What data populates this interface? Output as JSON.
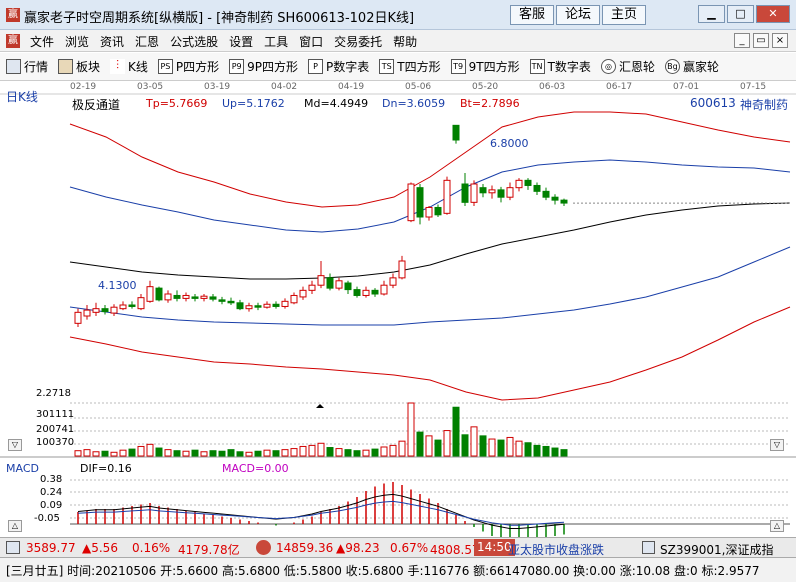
{
  "window": {
    "app_glyph": "赢",
    "title": "赢家老子时空周期系统[纵横版] - [神奇制药  SH600613-102日K线]",
    "buttons": [
      "客服",
      "论坛",
      "主页"
    ],
    "controls": [
      "▁",
      "□",
      "✕"
    ]
  },
  "menu": {
    "items": [
      "文件",
      "浏览",
      "资讯",
      "汇恩",
      "公式选股",
      "设置",
      "工具",
      "窗口",
      "交易委托",
      "帮助"
    ],
    "mdi_controls": [
      "_",
      "▭",
      "×"
    ]
  },
  "toolbar": {
    "items": [
      {
        "label": "行情",
        "icon": "grid-icon"
      },
      {
        "label": "板块",
        "icon": "blocks-icon"
      },
      {
        "label": "K线",
        "icon": "candle-icon"
      },
      {
        "label": "P四方形",
        "icon": "ps-icon",
        "glyph": "PS"
      },
      {
        "label": "9P四方形",
        "icon": "p9-icon",
        "glyph": "P9"
      },
      {
        "label": "P数字表",
        "icon": "p-table-icon",
        "glyph": "P"
      },
      {
        "label": "T四方形",
        "icon": "ts-icon",
        "glyph": "TS"
      },
      {
        "label": "9T四方形",
        "icon": "t9-icon",
        "glyph": "T9"
      },
      {
        "label": "T数字表",
        "icon": "tn-icon",
        "glyph": "TN"
      },
      {
        "label": "汇恩轮",
        "icon": "wheel-icon",
        "glyph": "◎"
      },
      {
        "label": "赢家轮",
        "icon": "big-icon",
        "glyph": "Bg"
      }
    ]
  },
  "chart": {
    "period_label": "日K线",
    "dates": [
      "02-19",
      "03-05",
      "03-19",
      "04-02",
      "04-19",
      "05-06",
      "05-20",
      "06-03",
      "06-17",
      "07-01",
      "07-15"
    ],
    "indicator_name": "极反通道",
    "params": [
      {
        "label": "Tp=5.7669",
        "color": "#d00000"
      },
      {
        "label": "Up=5.1762",
        "color": "#1a3fa8"
      },
      {
        "label": "Md=4.4949",
        "color": "#000000"
      },
      {
        "label": "Dn=3.6059",
        "color": "#1a3fa8"
      },
      {
        "label": "Bt=2.7896",
        "color": "#d00000"
      }
    ],
    "stock_code": "600613",
    "stock_name": "神奇制药",
    "high_label": "6.8000",
    "low_label": "4.1300",
    "volume_labels": [
      "2.2718",
      "301111",
      "200741",
      "100370"
    ],
    "macd_title": "MACD",
    "dif_label": "DIF=0.16",
    "macd_label": "MACD=0.00",
    "macd_axis": [
      "0.38",
      "0.24",
      "0.09",
      "-0.05"
    ],
    "colors": {
      "up": "#d00000",
      "down": "#008000",
      "ma": "#000000",
      "band": "#1a3fa8"
    }
  },
  "status": {
    "index1_value": "3589.77",
    "index1_change": "▲5.56",
    "index1_pct": "0.16%",
    "index1_amount": "4179.78亿",
    "index2_value": "14859.36",
    "index2_change": "▲98.23",
    "index2_pct": "0.67%",
    "index2_amount": "4808.57亿",
    "time": "14:50",
    "scroll_news": "亚太股市收盘涨跌",
    "stock_ref": "SZ399001,深证成指"
  },
  "infobar": {
    "text": "[三月廿五] 时间:20210506 开:5.6600 高:5.6800 低:5.5800 收:5.6800 手:116776 额:66147080.00 换:0.00 涨:10.08 盘:0 标:2.9577"
  },
  "chart_data": {
    "type": "candlestick",
    "title": "神奇制药 SH600613 日K线",
    "price_range": [
      3.6,
      6.8
    ],
    "candles": [
      {
        "o": 4.1,
        "c": 4.25,
        "h": 4.3,
        "l": 4.05
      },
      {
        "o": 4.2,
        "c": 4.28,
        "h": 4.35,
        "l": 4.15
      },
      {
        "o": 4.25,
        "c": 4.3,
        "h": 4.38,
        "l": 4.2
      },
      {
        "o": 4.3,
        "c": 4.26,
        "h": 4.35,
        "l": 4.22
      },
      {
        "o": 4.24,
        "c": 4.32,
        "h": 4.36,
        "l": 4.2
      },
      {
        "o": 4.3,
        "c": 4.35,
        "h": 4.4,
        "l": 4.28
      },
      {
        "o": 4.35,
        "c": 4.33,
        "h": 4.4,
        "l": 4.3
      },
      {
        "o": 4.3,
        "c": 4.45,
        "h": 4.5,
        "l": 4.28
      },
      {
        "o": 4.4,
        "c": 4.6,
        "h": 4.68,
        "l": 4.38
      },
      {
        "o": 4.58,
        "c": 4.42,
        "h": 4.6,
        "l": 4.4
      },
      {
        "o": 4.42,
        "c": 4.5,
        "h": 4.55,
        "l": 4.38
      },
      {
        "o": 4.48,
        "c": 4.44,
        "h": 4.55,
        "l": 4.4
      },
      {
        "o": 4.44,
        "c": 4.48,
        "h": 4.52,
        "l": 4.4
      },
      {
        "o": 4.46,
        "c": 4.44,
        "h": 4.5,
        "l": 4.4
      },
      {
        "o": 4.44,
        "c": 4.47,
        "h": 4.5,
        "l": 4.4
      },
      {
        "o": 4.46,
        "c": 4.43,
        "h": 4.5,
        "l": 4.4
      },
      {
        "o": 4.42,
        "c": 4.4,
        "h": 4.46,
        "l": 4.36
      },
      {
        "o": 4.4,
        "c": 4.38,
        "h": 4.45,
        "l": 4.35
      },
      {
        "o": 4.38,
        "c": 4.3,
        "h": 4.42,
        "l": 4.28
      },
      {
        "o": 4.3,
        "c": 4.34,
        "h": 4.38,
        "l": 4.26
      },
      {
        "o": 4.34,
        "c": 4.32,
        "h": 4.38,
        "l": 4.28
      },
      {
        "o": 4.32,
        "c": 4.36,
        "h": 4.4,
        "l": 4.3
      },
      {
        "o": 4.36,
        "c": 4.33,
        "h": 4.4,
        "l": 4.3
      },
      {
        "o": 4.33,
        "c": 4.4,
        "h": 4.44,
        "l": 4.3
      },
      {
        "o": 4.38,
        "c": 4.48,
        "h": 4.52,
        "l": 4.36
      },
      {
        "o": 4.46,
        "c": 4.55,
        "h": 4.6,
        "l": 4.42
      },
      {
        "o": 4.55,
        "c": 4.62,
        "h": 4.68,
        "l": 4.5
      },
      {
        "o": 4.62,
        "c": 4.75,
        "h": 4.95,
        "l": 4.58
      },
      {
        "o": 4.72,
        "c": 4.58,
        "h": 4.78,
        "l": 4.55
      },
      {
        "o": 4.58,
        "c": 4.68,
        "h": 4.72,
        "l": 4.55
      },
      {
        "o": 4.65,
        "c": 4.56,
        "h": 4.68,
        "l": 4.5
      },
      {
        "o": 4.56,
        "c": 4.48,
        "h": 4.6,
        "l": 4.45
      },
      {
        "o": 4.48,
        "c": 4.55,
        "h": 4.6,
        "l": 4.45
      },
      {
        "o": 4.55,
        "c": 4.5,
        "h": 4.58,
        "l": 4.46
      },
      {
        "o": 4.5,
        "c": 4.62,
        "h": 4.68,
        "l": 4.48
      },
      {
        "o": 4.62,
        "c": 4.72,
        "h": 4.78,
        "l": 4.58
      },
      {
        "o": 4.72,
        "c": 4.95,
        "h": 5.02,
        "l": 4.7
      },
      {
        "o": 5.5,
        "c": 6.0,
        "h": 6.02,
        "l": 5.48
      },
      {
        "o": 5.95,
        "c": 5.55,
        "h": 6.0,
        "l": 5.45
      },
      {
        "o": 5.55,
        "c": 5.68,
        "h": 5.7,
        "l": 5.5
      },
      {
        "o": 5.68,
        "c": 5.58,
        "h": 5.72,
        "l": 5.55
      },
      {
        "o": 5.6,
        "c": 6.05,
        "h": 6.1,
        "l": 5.58
      },
      {
        "o": 6.8,
        "c": 6.6,
        "h": 6.8,
        "l": 6.55
      },
      {
        "o": 6.0,
        "c": 5.75,
        "h": 6.15,
        "l": 5.7
      },
      {
        "o": 5.75,
        "c": 6.0,
        "h": 6.05,
        "l": 5.7
      },
      {
        "o": 5.95,
        "c": 5.88,
        "h": 6.0,
        "l": 5.82
      },
      {
        "o": 5.88,
        "c": 5.92,
        "h": 5.98,
        "l": 5.8
      },
      {
        "o": 5.92,
        "c": 5.82,
        "h": 5.96,
        "l": 5.75
      },
      {
        "o": 5.82,
        "c": 5.95,
        "h": 6.02,
        "l": 5.78
      },
      {
        "o": 5.95,
        "c": 6.05,
        "h": 6.08,
        "l": 5.9
      },
      {
        "o": 6.05,
        "c": 5.98,
        "h": 6.08,
        "l": 5.92
      },
      {
        "o": 5.98,
        "c": 5.9,
        "h": 6.02,
        "l": 5.85
      },
      {
        "o": 5.9,
        "c": 5.82,
        "h": 5.95,
        "l": 5.78
      },
      {
        "o": 5.82,
        "c": 5.78,
        "h": 5.86,
        "l": 5.72
      },
      {
        "o": 5.78,
        "c": 5.74,
        "h": 5.8,
        "l": 5.7
      }
    ],
    "volumes": [
      10,
      12,
      8,
      9,
      7,
      11,
      13,
      18,
      22,
      15,
      12,
      10,
      9,
      11,
      8,
      10,
      9,
      12,
      8,
      7,
      9,
      11,
      10,
      12,
      14,
      18,
      20,
      24,
      16,
      14,
      12,
      10,
      11,
      13,
      17,
      20,
      28,
      100,
      45,
      38,
      30,
      48,
      92,
      40,
      55,
      38,
      32,
      30,
      35,
      28,
      25,
      20,
      18,
      15,
      12
    ],
    "macd_hist": [
      0.08,
      0.09,
      0.1,
      0.1,
      0.1,
      0.11,
      0.12,
      0.13,
      0.14,
      0.12,
      0.11,
      0.1,
      0.09,
      0.08,
      0.07,
      0.06,
      0.05,
      0.04,
      0.03,
      0.02,
      0.01,
      0.0,
      -0.01,
      0.0,
      0.01,
      0.03,
      0.05,
      0.08,
      0.1,
      0.12,
      0.15,
      0.18,
      0.22,
      0.25,
      0.27,
      0.28,
      0.26,
      0.23,
      0.2,
      0.17,
      0.14,
      0.1,
      0.06,
      0.02,
      -0.02,
      -0.05,
      -0.08,
      -0.1,
      -0.12,
      -0.12,
      -0.11,
      -0.1,
      -0.09,
      -0.08,
      -0.07
    ]
  }
}
